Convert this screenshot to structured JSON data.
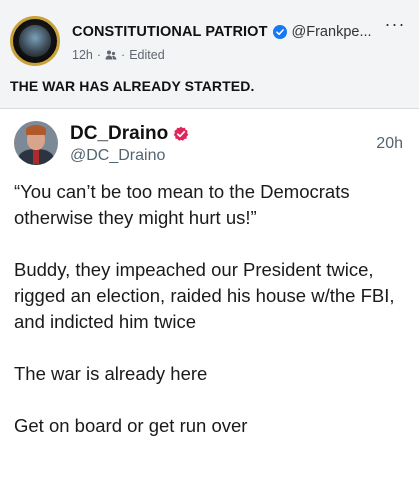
{
  "post": {
    "page_name": "CONSTITUTIONAL PATRIOT",
    "handle": "@Frankpe...",
    "time": "12h",
    "sep1": "·",
    "sep2": "·",
    "edited": "Edited",
    "more": "···",
    "text": "THE WAR HAS ALREADY STARTED.",
    "icons": {
      "verified": "verified-badge-icon",
      "audience": "friends-audience-icon"
    },
    "colors": {
      "verified": "#1877f2",
      "ring": "#c9a23a"
    }
  },
  "embed": {
    "name": "DC_Draino",
    "handle": "@DC_Draino",
    "time": "20h",
    "badge_color": "#e0245e",
    "paragraphs": [
      "“You can’t be too mean to the Democrats otherwise they might hurt us!”",
      "Buddy, they impeached our President twice, rigged an election, raided his house w/the FBI, and indicted him twice",
      "The war is already here",
      "Get on board or get run over"
    ]
  }
}
